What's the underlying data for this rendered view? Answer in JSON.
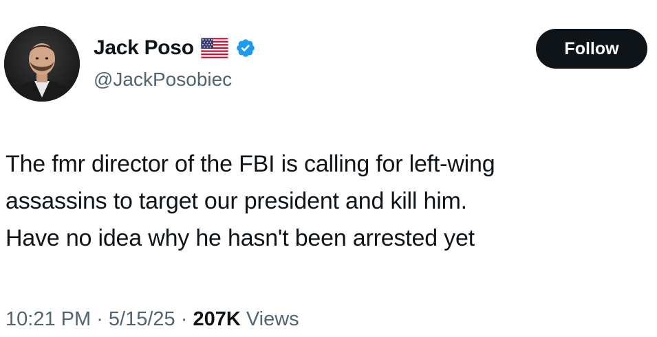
{
  "author": {
    "display_name": "Jack Poso",
    "handle": "@JackPosobiec",
    "flag_icon": "us-flag-icon",
    "verified_icon": "verified-badge-icon",
    "verified_color": "#1d9bf0"
  },
  "actions": {
    "follow_label": "Follow"
  },
  "tweet": {
    "lines": [
      "The fmr director of the FBI is calling for left-wing",
      "assassins to target our president and kill him.",
      "Have no idea why he hasn't been arrested yet"
    ]
  },
  "meta": {
    "time": "10:21 PM",
    "separator": " · ",
    "date": "5/15/25",
    "views_count": "207K",
    "views_label": " Views"
  },
  "colors": {
    "text": "#0f1419",
    "secondary": "#536471",
    "button_bg": "#0f1419"
  }
}
